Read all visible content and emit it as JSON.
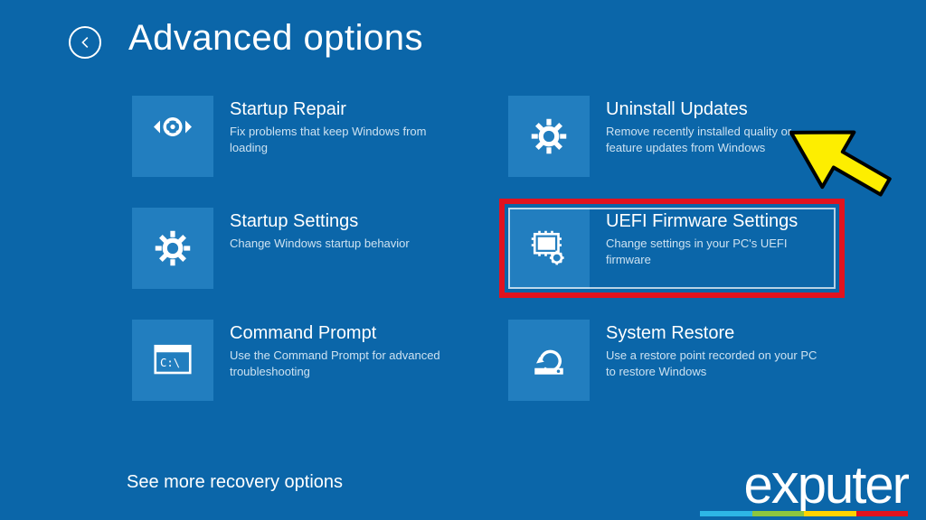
{
  "header": {
    "title": "Advanced options"
  },
  "tiles": {
    "startup_repair": {
      "title": "Startup Repair",
      "desc": "Fix problems that keep Windows from loading"
    },
    "uninstall_updates": {
      "title": "Uninstall Updates",
      "desc": "Remove recently installed quality or feature updates from Windows"
    },
    "startup_settings": {
      "title": "Startup Settings",
      "desc": "Change Windows startup behavior"
    },
    "uefi": {
      "title": "UEFI Firmware Settings",
      "desc": "Change settings in your PC's UEFI firmware"
    },
    "command_prompt": {
      "title": "Command Prompt",
      "desc": "Use the Command Prompt for advanced troubleshooting"
    },
    "system_restore": {
      "title": "System Restore",
      "desc": "Use a restore point recorded on your PC to restore Windows"
    }
  },
  "see_more": "See more recovery options",
  "logo_text": "exputer",
  "annotation": {
    "highlighted_tile": "uefi",
    "arrow_color": "#fdee00"
  }
}
